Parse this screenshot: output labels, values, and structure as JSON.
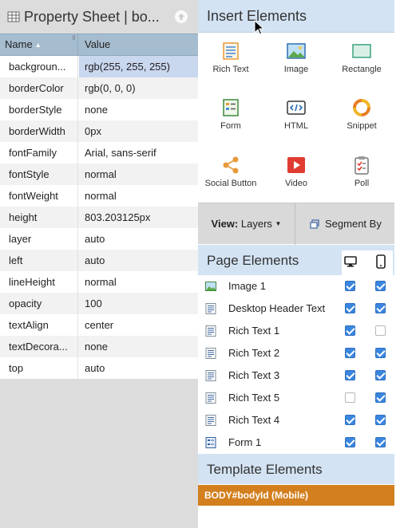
{
  "property_sheet": {
    "title": "Property Sheet | bo...",
    "columns": {
      "name": "Name",
      "value": "Value"
    },
    "rows": [
      {
        "name": "backgroun...",
        "value": "rgb(255, 255, 255)"
      },
      {
        "name": "borderColor",
        "value": "rgb(0, 0, 0)"
      },
      {
        "name": "borderStyle",
        "value": "none"
      },
      {
        "name": "borderWidth",
        "value": "0px"
      },
      {
        "name": "fontFamily",
        "value": "Arial, sans-serif"
      },
      {
        "name": "fontStyle",
        "value": "normal"
      },
      {
        "name": "fontWeight",
        "value": "normal"
      },
      {
        "name": "height",
        "value": "803.203125px"
      },
      {
        "name": "layer",
        "value": "auto"
      },
      {
        "name": "left",
        "value": "auto"
      },
      {
        "name": "lineHeight",
        "value": "normal"
      },
      {
        "name": "opacity",
        "value": "100"
      },
      {
        "name": "textAlign",
        "value": "center"
      },
      {
        "name": "textDecora...",
        "value": "none"
      },
      {
        "name": "top",
        "value": "auto"
      }
    ]
  },
  "insert_elements": {
    "title": "Insert Elements",
    "tiles": [
      {
        "label": "Rich Text",
        "icon": "rich-text-icon"
      },
      {
        "label": "Image",
        "icon": "image-icon"
      },
      {
        "label": "Rectangle",
        "icon": "rectangle-icon"
      },
      {
        "label": "Form",
        "icon": "form-icon"
      },
      {
        "label": "HTML",
        "icon": "html-icon"
      },
      {
        "label": "Snippet",
        "icon": "snippet-icon"
      },
      {
        "label": "Social Button",
        "icon": "social-button-icon"
      },
      {
        "label": "Video",
        "icon": "video-icon"
      },
      {
        "label": "Poll",
        "icon": "poll-icon"
      }
    ]
  },
  "view_bar": {
    "view_prefix": "View:",
    "view_value": "Layers",
    "segment_label": "Segment By"
  },
  "page_elements": {
    "title": "Page Elements",
    "items": [
      {
        "label": "Image 1",
        "icon": "image-icon",
        "desktop": true,
        "mobile": true
      },
      {
        "label": "Desktop Header Text",
        "icon": "text-icon",
        "desktop": true,
        "mobile": true
      },
      {
        "label": "Rich Text 1",
        "icon": "text-icon",
        "desktop": true,
        "mobile": false
      },
      {
        "label": "Rich Text 2",
        "icon": "text-icon",
        "desktop": true,
        "mobile": true
      },
      {
        "label": "Rich Text 3",
        "icon": "text-icon",
        "desktop": true,
        "mobile": true
      },
      {
        "label": "Rich Text 5",
        "icon": "text-icon",
        "desktop": false,
        "mobile": true
      },
      {
        "label": "Rich Text 4",
        "icon": "text-icon",
        "desktop": true,
        "mobile": true
      },
      {
        "label": "Form 1",
        "icon": "form-icon",
        "desktop": true,
        "mobile": true
      }
    ]
  },
  "template_elements": {
    "title": "Template Elements",
    "body_row": "BODY#bodyId (Mobile)"
  },
  "colors": {
    "section_header": "#d3e3f3",
    "column_header": "#a6bdd0",
    "selected_value": "#c9d7ef",
    "checkbox": "#3a86df",
    "template_row": "#d37f1e"
  }
}
